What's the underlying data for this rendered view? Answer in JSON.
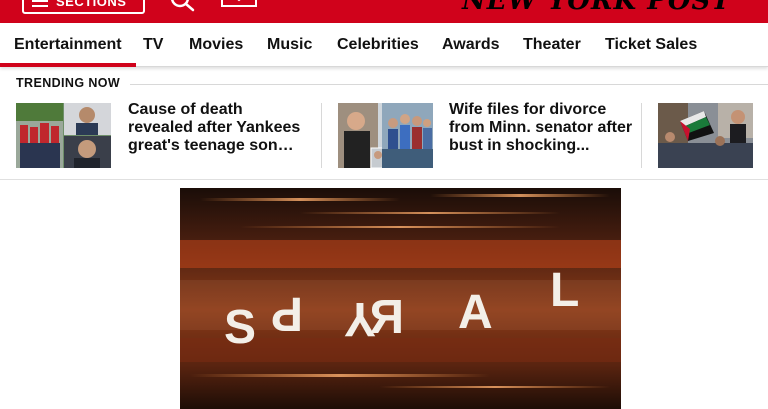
{
  "header": {
    "sections_label": "SECTIONS",
    "logo_text": "NEW YORK POST",
    "brand_color": "#d0021b"
  },
  "nav": {
    "items": [
      "Entertainment",
      "TV",
      "Movies",
      "Music",
      "Celebrities",
      "Awards",
      "Theater",
      "Ticket Sales"
    ],
    "active_index": 0
  },
  "trending": {
    "label": "TRENDING NOW",
    "stories": [
      {
        "headline": "Cause of death revealed after Yankees great's teenage son…"
      },
      {
        "headline": "Wife files for divorce from Minn. senator after bust in shocking..."
      },
      {
        "headline": ""
      }
    ]
  },
  "hero": {
    "title_letters": [
      "S",
      "P",
      "Y",
      "R",
      "A",
      "L"
    ]
  },
  "icons": {
    "menu": "hamburger-icon",
    "search": "search-icon",
    "mail": "mail-icon"
  }
}
